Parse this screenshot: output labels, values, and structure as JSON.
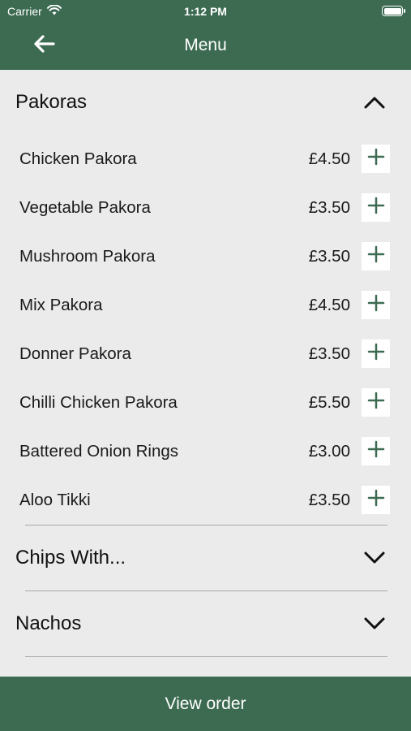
{
  "status_bar": {
    "carrier": "Carrier",
    "time": "1:12 PM"
  },
  "nav": {
    "title": "Menu"
  },
  "sections": [
    {
      "title": "Pakoras",
      "expanded": true,
      "items": [
        {
          "name": "Chicken Pakora",
          "price": "£4.50"
        },
        {
          "name": "Vegetable Pakora",
          "price": "£3.50"
        },
        {
          "name": "Mushroom Pakora",
          "price": "£3.50"
        },
        {
          "name": "Mix Pakora",
          "price": "£4.50"
        },
        {
          "name": "Donner Pakora",
          "price": "£3.50"
        },
        {
          "name": "Chilli Chicken Pakora",
          "price": "£5.50"
        },
        {
          "name": "Battered Onion Rings",
          "price": "£3.00"
        },
        {
          "name": "Aloo Tikki",
          "price": "£3.50"
        }
      ]
    },
    {
      "title": "Chips With...",
      "expanded": false
    },
    {
      "title": "Nachos",
      "expanded": false
    }
  ],
  "bottom_bar": {
    "label": "View order"
  },
  "colors": {
    "brand_green": "#3d6b52",
    "background": "#ebebeb",
    "accent_icon": "#3d6b52"
  }
}
